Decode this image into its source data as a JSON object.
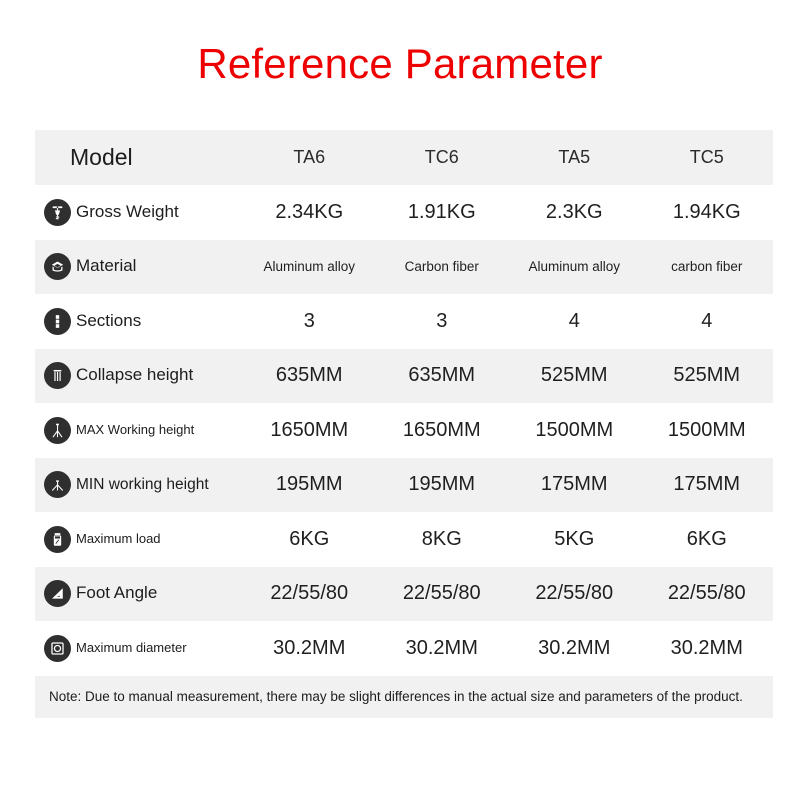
{
  "title": "Reference Parameter",
  "colors": {
    "title": "#ee0000",
    "row_shaded": "#f1f1f1",
    "row_plain": "#ffffff",
    "icon_badge": "#2f2f2f",
    "text": "#1d1d1d"
  },
  "table": {
    "header": {
      "label": "Model",
      "columns": [
        "TA6",
        "TC6",
        "TA5",
        "TC5"
      ]
    },
    "rows": [
      {
        "icon": "hanging-scale-icon",
        "label": "Gross Weight",
        "label_size": "lg",
        "value_size": "normal",
        "values": [
          "2.34KG",
          "1.91KG",
          "2.3KG",
          "1.94KG"
        ]
      },
      {
        "icon": "material-layers-icon",
        "label": "Material",
        "label_size": "lg",
        "value_size": "small",
        "values": [
          "Aluminum alloy",
          "Carbon fiber",
          "Aluminum alloy",
          "carbon fiber"
        ]
      },
      {
        "icon": "tube-sections-icon",
        "label": "Sections",
        "label_size": "lg",
        "value_size": "normal",
        "values": [
          "3",
          "3",
          "4",
          "4"
        ]
      },
      {
        "icon": "folded-tripod-icon",
        "label": "Collapse height",
        "label_size": "lg",
        "value_size": "normal",
        "values": [
          "635MM",
          "635MM",
          "525MM",
          "525MM"
        ]
      },
      {
        "icon": "tripod-tall-icon",
        "label": "MAX Working height",
        "label_size": "sm",
        "value_size": "normal",
        "values": [
          "1650MM",
          "1650MM",
          "1500MM",
          "1500MM"
        ]
      },
      {
        "icon": "tripod-low-icon",
        "label": "MIN working height",
        "label_size": "normal",
        "value_size": "normal",
        "values": [
          "195MM",
          "195MM",
          "175MM",
          "175MM"
        ]
      },
      {
        "icon": "max-load-icon",
        "label": "Maximum load",
        "label_size": "sm",
        "value_size": "normal",
        "values": [
          "6KG",
          "8KG",
          "5KG",
          "6KG"
        ]
      },
      {
        "icon": "foot-angle-icon",
        "label": "Foot Angle",
        "label_size": "lg",
        "value_size": "normal",
        "values": [
          "22/55/80",
          "22/55/80",
          "22/55/80",
          "22/55/80"
        ]
      },
      {
        "icon": "diameter-icon",
        "label": "Maximum diameter",
        "label_size": "sm",
        "value_size": "normal",
        "values": [
          "30.2MM",
          "30.2MM",
          "30.2MM",
          "30.2MM"
        ]
      }
    ]
  },
  "note": "Note: Due to manual measurement, there may be slight differences in the actual size and parameters of the product."
}
